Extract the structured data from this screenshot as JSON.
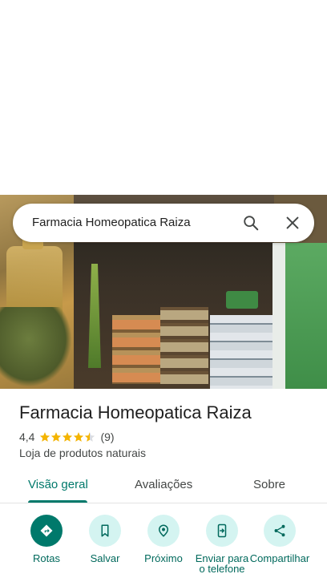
{
  "search": {
    "query": "Farmacia Homeopatica Raiza",
    "search_icon": "search-icon",
    "close_icon": "close-icon"
  },
  "place": {
    "name": "Farmacia Homeopatica Raiza",
    "rating": "4,4",
    "rating_value": 4.4,
    "review_count": "(9)",
    "category": "Loja de produtos naturais"
  },
  "tabs": [
    {
      "label": "Visão geral",
      "active": true
    },
    {
      "label": "Avaliações",
      "active": false
    },
    {
      "label": "Sobre",
      "active": false
    }
  ],
  "actions": [
    {
      "label": "Rotas",
      "icon": "directions-icon"
    },
    {
      "label": "Salvar",
      "icon": "bookmark-icon"
    },
    {
      "label": "Próximo",
      "icon": "nearby-icon"
    },
    {
      "label": "Enviar para o telefone",
      "icon": "send-to-phone-icon"
    },
    {
      "label": "Compartilhar",
      "icon": "share-icon"
    }
  ],
  "colors": {
    "accent": "#00796b",
    "action_bg": "#d4f4f1",
    "star": "#f4b400"
  }
}
